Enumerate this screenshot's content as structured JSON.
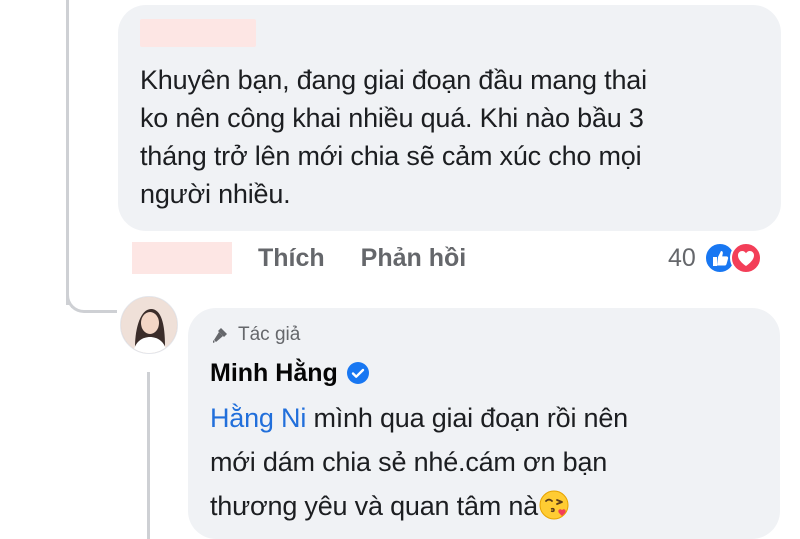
{
  "comment": {
    "text": "Khuyên bạn, đang giai đoạn đầu mang thai\nko nên công khai nhiều quá. Khi nào bầu 3\ntháng trở lên mới chia sẽ cảm xúc cho mọi\nngười nhiều.",
    "actions": {
      "like": "Thích",
      "reply": "Phản hồi"
    },
    "reaction_count": "40",
    "reaction_icons": [
      "like-reaction-icon",
      "love-reaction-icon"
    ]
  },
  "reply": {
    "badge": "Tác giả",
    "author": "Minh Hằng",
    "mention": "Hằng Ni",
    "text_1": " mình qua giai đoạn rồi nên",
    "text_2": "mới dám chia sẻ nhé.cám ơn bạn",
    "text_3": "thương yêu và quan tâm nà",
    "emoji": "face-blowing-kiss-icon"
  },
  "colors": {
    "bubble": "#f0f2f5",
    "mention": "#216fdb",
    "secondary_text": "#65676b",
    "like_blue": "#1877f2",
    "love_red": "#f33e58",
    "redaction": "#fde6e4"
  }
}
